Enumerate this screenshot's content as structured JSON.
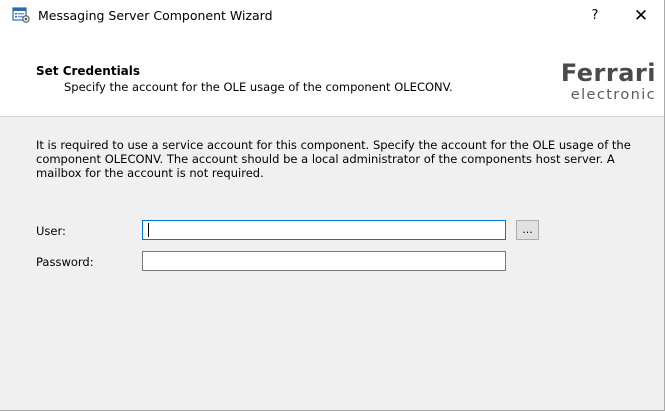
{
  "window": {
    "title": "Messaging Server Component Wizard",
    "help_button": "?",
    "close_button": "✕"
  },
  "header": {
    "title": "Set Credentials",
    "subtitle": "Specify the account for the OLE usage of the component OLECONV.",
    "logo_top": "Ferrari",
    "logo_bottom": "electronic"
  },
  "body": {
    "description": "It is required to use a service account for this component. Specify the account for the OLE usage of the component OLECONV. The account should be a local administrator of the components host server. A mailbox for the account is not required."
  },
  "form": {
    "user_label": "User:",
    "user_value": "",
    "browse_button": "...",
    "password_label": "Password:",
    "password_value": ""
  },
  "colors": {
    "focus_border": "#0078d7",
    "window_background": "#f0f0f0",
    "header_background": "#ffffff"
  }
}
